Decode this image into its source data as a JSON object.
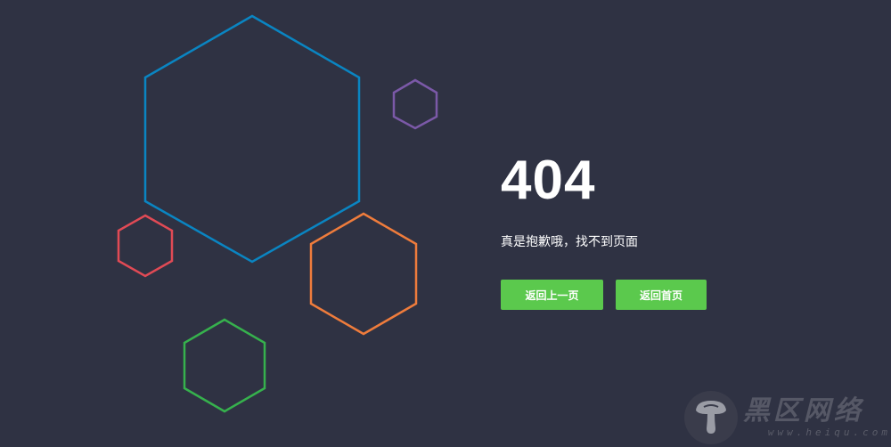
{
  "error": {
    "code": "404",
    "message": "真是抱歉哦，找不到页面"
  },
  "buttons": {
    "back_label": "返回上一页",
    "home_label": "返回首页"
  },
  "colors": {
    "background": "#2f3243",
    "button": "#5bc94d",
    "hex_blue": "#0a85c2",
    "hex_purple": "#7b59a8",
    "hex_red": "#e14a55",
    "hex_orange": "#ef7c3c",
    "hex_green": "#36b14d"
  },
  "watermark": {
    "title": "黑区网络",
    "subtitle": "www.heiqu.com",
    "logo_icon": "mushroom-icon"
  }
}
